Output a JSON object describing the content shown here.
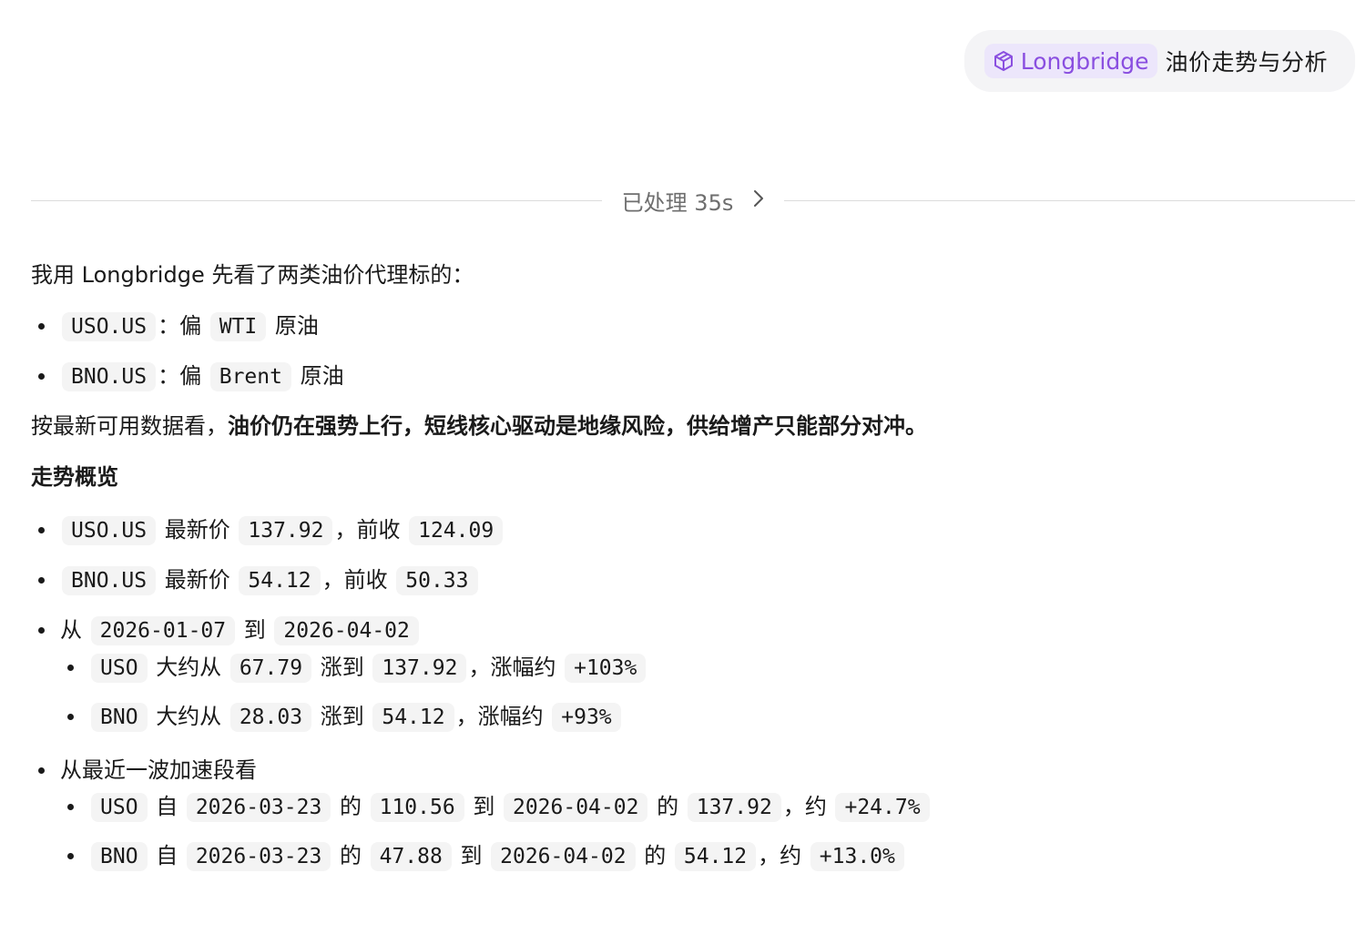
{
  "user_message": {
    "mention": "Longbridge",
    "mention_icon": "longbridge-cube-icon",
    "accent_color": "#8a4fe0",
    "text": "油价走势与分析"
  },
  "processed": {
    "label": "已处理 35s",
    "icon": "chevron-right-icon"
  },
  "answer": {
    "intro": "我用 Longbridge 先看了两类油价代理标的：",
    "proxies": [
      {
        "code": "USO.US",
        "sep": "：偏",
        "bench": "WTI",
        "suffix": "原油"
      },
      {
        "code": "BNO.US",
        "sep": "：偏",
        "bench": "Brent",
        "suffix": "原油"
      }
    ],
    "summary_prefix": "按最新可用数据看，",
    "summary_bold": "油价仍在强势上行，短线核心驱动是地缘风险，供给增产只能部分对冲。",
    "heading": "走势概览",
    "quotes": [
      {
        "code": "USO.US",
        "latest_label": "最新价",
        "latest": "137.92",
        "sep": "，前收",
        "prev": "124.09"
      },
      {
        "code": "BNO.US",
        "latest_label": "最新价",
        "latest": "54.12",
        "sep": "，前收",
        "prev": "50.33"
      }
    ],
    "range1": {
      "from_label": "从",
      "start": "2026-01-07",
      "to_label": "到",
      "end": "2026-04-02",
      "items": [
        {
          "code": "USO",
          "t1": "大约从",
          "from": "67.79",
          "t2": "涨到",
          "to": "137.92",
          "t3": "，涨幅约",
          "chg": "+103%"
        },
        {
          "code": "BNO",
          "t1": "大约从",
          "from": "28.03",
          "t2": "涨到",
          "to": "54.12",
          "t3": "，涨幅约",
          "chg": "+93%"
        }
      ]
    },
    "range2": {
      "label": "从最近一波加速段看",
      "items": [
        {
          "code": "USO",
          "t1": "自",
          "d1": "2026-03-23",
          "t2": "的",
          "v1": "110.56",
          "t3": "到",
          "d2": "2026-04-02",
          "t4": "的",
          "v2": "137.92",
          "t5": "，约",
          "chg": "+24.7%"
        },
        {
          "code": "BNO",
          "t1": "自",
          "d1": "2026-03-23",
          "t2": "的",
          "v1": "47.88",
          "t3": "到",
          "d2": "2026-04-02",
          "t4": "的",
          "v2": "54.12",
          "t5": "，约",
          "chg": "+13.0%"
        }
      ]
    }
  }
}
